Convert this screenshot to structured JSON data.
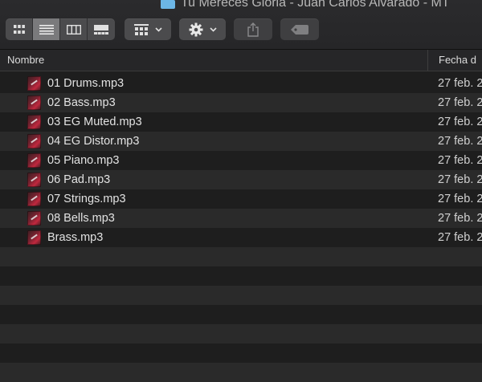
{
  "window": {
    "title": "Tu Mereces Gloria - Juan Carlos Alvarado - MT",
    "folder_icon": "folder-icon"
  },
  "toolbar": {
    "view_modes": [
      {
        "name": "icon-view",
        "icon": "grid-icon",
        "active": false
      },
      {
        "name": "list-view",
        "icon": "list-icon",
        "active": true
      },
      {
        "name": "column-view",
        "icon": "columns-icon",
        "active": false
      },
      {
        "name": "gallery-view",
        "icon": "gallery-icon",
        "active": false
      }
    ],
    "group_button_icon": "group-grid-icon",
    "action_button_icon": "gear-icon",
    "share_button_icon": "share-icon",
    "tag_button_icon": "tag-icon"
  },
  "columns": {
    "name": "Nombre",
    "date": "Fecha d"
  },
  "files": [
    {
      "name": "01 Drums.mp3",
      "date": "27 feb. 2"
    },
    {
      "name": "02 Bass.mp3",
      "date": "27 feb. 2"
    },
    {
      "name": "03 EG Muted.mp3",
      "date": "27 feb. 2"
    },
    {
      "name": "04 EG Distor.mp3",
      "date": "27 feb. 2"
    },
    {
      "name": "05 Piano.mp3",
      "date": "27 feb. 2"
    },
    {
      "name": "06 Pad.mp3",
      "date": "27 feb. 2"
    },
    {
      "name": "07 Strings.mp3",
      "date": "27 feb. 2"
    },
    {
      "name": "08 Bells.mp3",
      "date": "27 feb. 2"
    },
    {
      "name": "Brass.mp3",
      "date": "27 feb. 2"
    }
  ],
  "colors": {
    "background": "#1e1e1e",
    "row_alt": "#2a2a2a",
    "toolbar": "#2b2b2d",
    "text": "#e2e2e2",
    "folder": "#6cb6e6"
  }
}
